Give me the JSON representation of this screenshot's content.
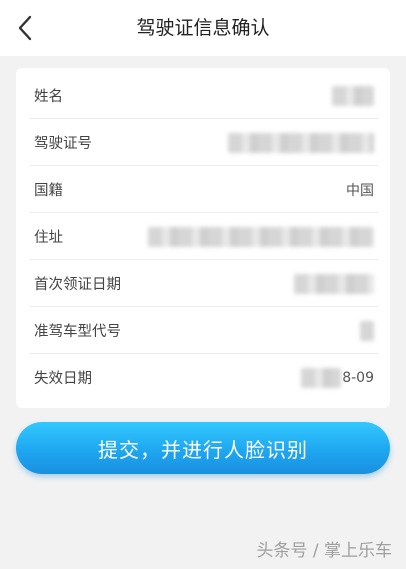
{
  "header": {
    "title": "驾驶证信息确认",
    "back_icon": "chevron-left-icon"
  },
  "fields": [
    {
      "label": "姓名",
      "value": ""
    },
    {
      "label": "驾驶证号",
      "value": ""
    },
    {
      "label": "国籍",
      "value": "中国"
    },
    {
      "label": "住址",
      "value": ""
    },
    {
      "label": "首次领证日期",
      "value": ""
    },
    {
      "label": "准驾车型代号",
      "value": ""
    },
    {
      "label": "失效日期",
      "value": "8-09"
    }
  ],
  "submit_label": "提交，并进行人脸识别",
  "watermark": "头条号 / 掌上乐车",
  "colors": {
    "button": "#1ea7f0",
    "background": "#f2f2f2"
  }
}
